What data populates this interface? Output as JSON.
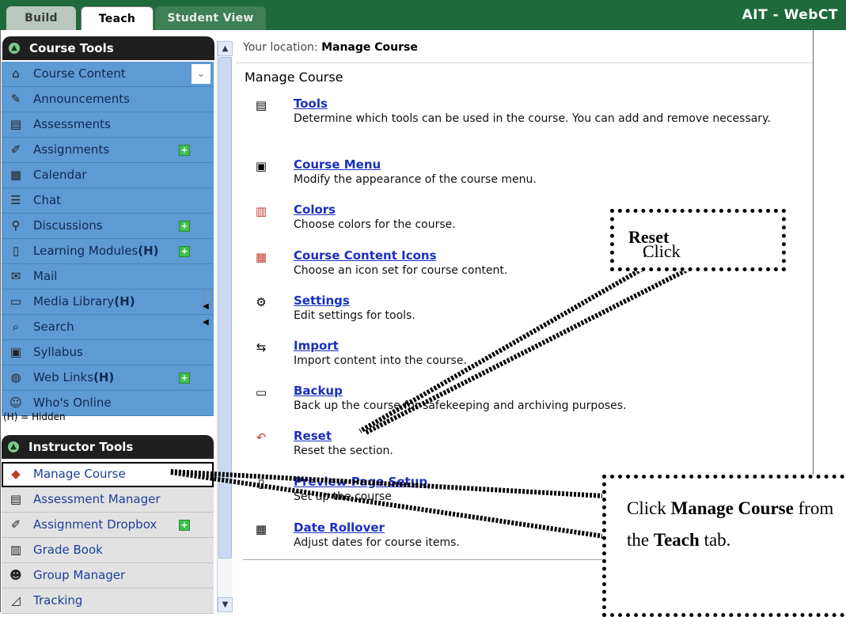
{
  "tabs": {
    "build": "Build",
    "teach": "Teach",
    "student_view": "Student View"
  },
  "brand": "AIT - WebCT",
  "course_tools": {
    "title": "Course Tools",
    "collapse_icon": "double-chevron-down-icon",
    "items": [
      {
        "label": "Course Content",
        "hidden": "",
        "icon": "house-icon"
      },
      {
        "label": "Announcements",
        "hidden": "",
        "icon": "megaphone-icon"
      },
      {
        "label": "Assessments",
        "hidden": "",
        "icon": "clipboard-icon"
      },
      {
        "label": "Assignments",
        "hidden": "",
        "icon": "pencil-icon",
        "new": true
      },
      {
        "label": "Calendar",
        "hidden": "",
        "icon": "calendar-icon"
      },
      {
        "label": "Chat",
        "hidden": "",
        "icon": "speech-bubble-icon"
      },
      {
        "label": "Discussions",
        "hidden": "",
        "icon": "pin-icon",
        "new": true
      },
      {
        "label": "Learning Modules",
        "hidden": "(H)",
        "icon": "document-icon",
        "new": true
      },
      {
        "label": "Mail",
        "hidden": "",
        "icon": "envelope-icon"
      },
      {
        "label": "Media Library",
        "hidden": "(H)",
        "icon": "media-icon"
      },
      {
        "label": "Search",
        "hidden": "",
        "icon": "magnifier-icon"
      },
      {
        "label": "Syllabus",
        "hidden": "",
        "icon": "syllabus-icon"
      },
      {
        "label": "Web Links",
        "hidden": "(H)",
        "icon": "globe-icon",
        "new": true
      },
      {
        "label": "Who's Online",
        "hidden": "",
        "icon": "person-icon"
      }
    ],
    "hidden_note": "(H) = Hidden"
  },
  "instructor_tools": {
    "title": "Instructor Tools",
    "items": [
      {
        "label": "Manage Course",
        "icon": "toolbox-icon",
        "active": true
      },
      {
        "label": "Assessment Manager",
        "icon": "clipboard-icon"
      },
      {
        "label": "Assignment Dropbox",
        "icon": "dropbox-icon",
        "new": true
      },
      {
        "label": "Grade Book",
        "icon": "gradebook-icon"
      },
      {
        "label": "Group Manager",
        "icon": "group-icon"
      },
      {
        "label": "Tracking",
        "icon": "chart-icon"
      }
    ]
  },
  "main": {
    "location_prefix": "Your location:",
    "location_value": "Manage Course",
    "title": "Manage Course",
    "entries": [
      {
        "link": "Tools",
        "desc": "Determine which tools can be used in the course. You can add and remove necessary.",
        "icon": "tools-icon"
      },
      {
        "link": "Course Menu",
        "desc": "Modify the appearance of the course menu.",
        "icon": "menu-icon"
      },
      {
        "link": "Colors",
        "desc": "Choose colors for the course.",
        "icon": "colors-icon"
      },
      {
        "link": "Course Content Icons",
        "desc": "Choose an icon set for course content.",
        "icon": "icons-icon"
      },
      {
        "link": "Settings",
        "desc": "Edit settings for tools.",
        "icon": "settings-icon"
      },
      {
        "link": "Import",
        "desc": "Import content into the course.",
        "icon": "import-icon"
      },
      {
        "link": "Backup",
        "desc": "Back up the course for safekeeping and archiving purposes.",
        "icon": "backup-icon"
      },
      {
        "link": "Reset",
        "desc": "Reset the section.",
        "icon": "reset-icon"
      },
      {
        "link": "Preview Page Setup",
        "desc": "Set up the course",
        "icon": "preview-icon"
      },
      {
        "link": "Date Rollover",
        "desc": "Adjust dates for course items.",
        "icon": "calendar-icon"
      }
    ]
  },
  "callouts": {
    "reset_pre": "Click ",
    "reset_bold": "Reset",
    "reset_post": ".",
    "manage_pre": "Click ",
    "manage_bold": "Manage Course",
    "manage_mid": " from the ",
    "manage_teach": "Teach",
    "manage_post": " tab."
  }
}
